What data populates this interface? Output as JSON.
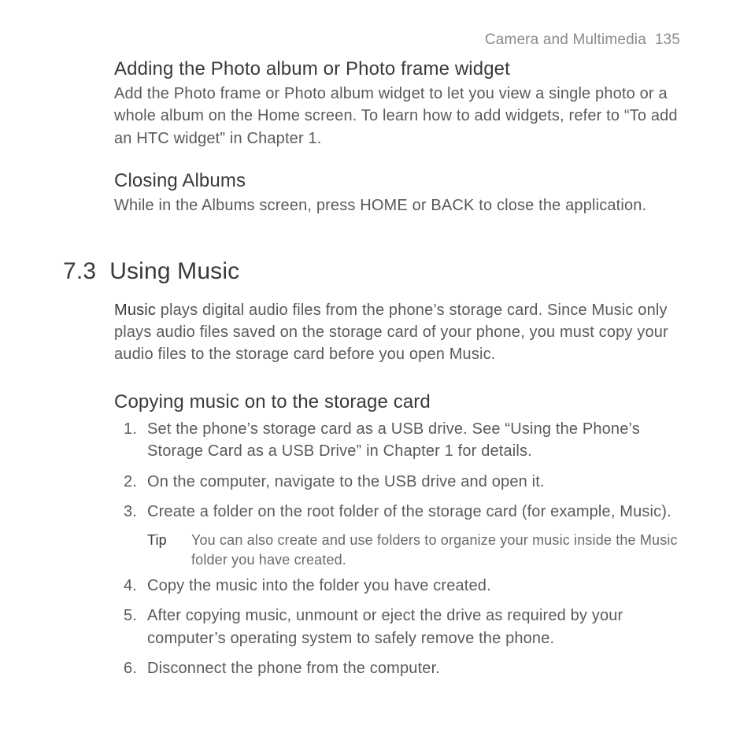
{
  "header": {
    "chapter_label": "Camera and Multimedia",
    "page_number": "135"
  },
  "section1": {
    "heading": "Adding the Photo album or Photo frame widget",
    "body": "Add the Photo frame or Photo album widget to let you view a single photo or a whole album on the Home screen. To learn how to add widgets, refer to “To add an HTC widget” in Chapter 1."
  },
  "section2": {
    "heading": "Closing Albums",
    "body": "While in the Albums screen, press HOME or BACK to close the application."
  },
  "chapter": {
    "number": "7.3",
    "title": "Using Music"
  },
  "intro": {
    "lead": "Music",
    "rest": " plays digital audio files from the phone’s storage card. Since Music only plays audio files saved on the storage card of your phone, you must copy your audio files to the storage card before you open Music."
  },
  "section3": {
    "heading": "Copying music on to the storage card",
    "steps": [
      "Set the phone’s storage card as a USB drive. See “Using the Phone’s Storage Card as a USB Drive” in Chapter 1 for details.",
      "On the computer, navigate to the USB drive and open it.",
      "Create a folder on the root folder of the storage card (for example, Music).",
      "Copy the music into the folder you have created.",
      "After copying music, unmount or eject the drive as required by your computer’s operating system to safely remove the phone.",
      "Disconnect the phone from the computer."
    ],
    "tip": {
      "label": "Tip",
      "text": "You can also create and use folders to organize your music inside the Music folder you have created."
    }
  }
}
